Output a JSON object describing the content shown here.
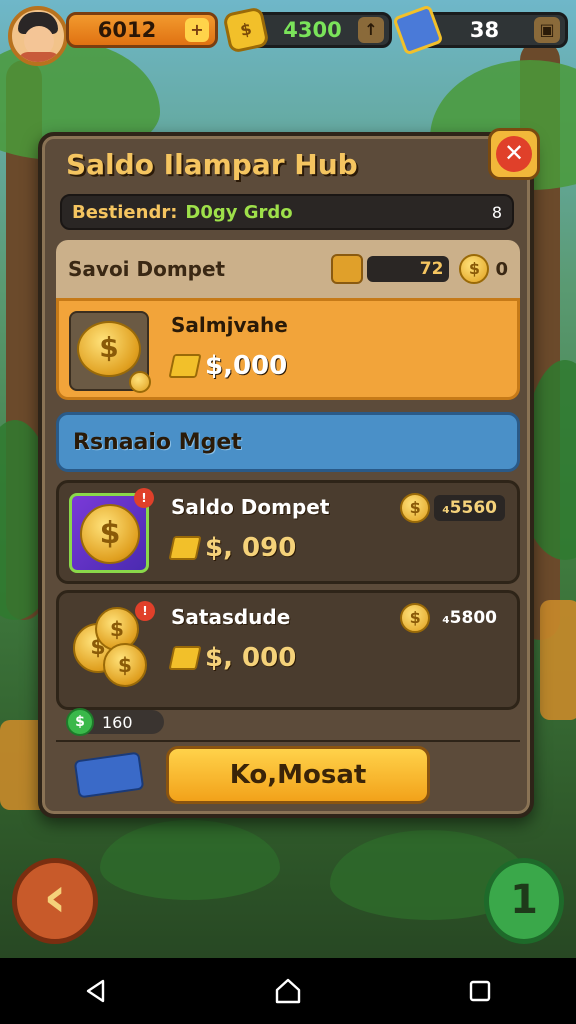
{
  "hud": {
    "level_value": "6012",
    "level_plus": "+",
    "gold_value": "4300",
    "gold_button": "↑",
    "gem_value": "38",
    "gem_button": "▣"
  },
  "panel": {
    "title": "Saldo Ilampar Hub",
    "close_label": "✕",
    "info": {
      "label": "Bestiendr:",
      "value": "D0gy Grdo",
      "count": "8"
    },
    "section": {
      "label": "Savoi Dompet",
      "bar_value": "72",
      "coin_symbol": "$",
      "zero": "0"
    },
    "selected_card": {
      "name": "Salmjvahe",
      "amount": "$,000",
      "coin_symbol": "$"
    },
    "banner": {
      "label": "Rsnaaio Mget"
    },
    "cards": [
      {
        "name": "Saldo Dompet",
        "amount": "$, 090",
        "price": "₄5560",
        "coin_symbol": "$",
        "badge": "!"
      },
      {
        "name": "Satasdude",
        "amount": "$, 000",
        "price": "₄5800",
        "coin_symbol": "$",
        "badge": "!"
      }
    ],
    "stat": {
      "icon": "$",
      "value": "160"
    },
    "confirm_label": "Ko,Mosat"
  },
  "controls": {
    "back_label": "‹",
    "next_label": "1"
  },
  "colors": {
    "accent": "#f2a43a",
    "banner": "#4a90c8",
    "panel": "#5c4b3a"
  }
}
